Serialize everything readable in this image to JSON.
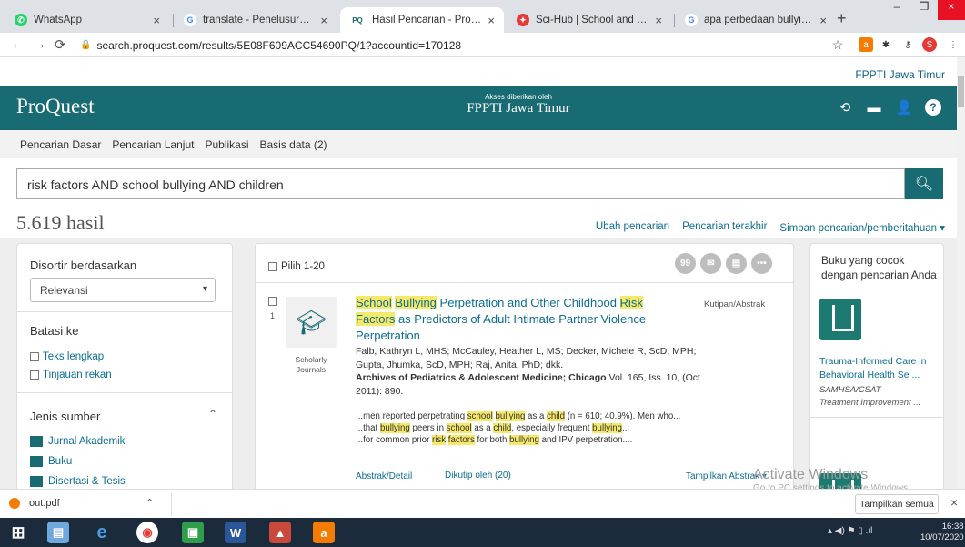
{
  "browser": {
    "tabs": [
      {
        "title": "WhatsApp",
        "color": "#25d366",
        "glyph": "W"
      },
      {
        "title": "translate - Penelusuran Google",
        "color": "#4285f4",
        "glyph": "G"
      },
      {
        "title": "Hasil Pencarian - ProQuest",
        "color": "#186b73",
        "glyph": "PQ"
      },
      {
        "title": "Sci-Hub | School and Family Fac",
        "color": "#e53935",
        "glyph": "S"
      },
      {
        "title": "apa perbedaan bullying dengan",
        "color": "#4285f4",
        "glyph": "G"
      }
    ],
    "url": "search.proquest.com/results/5E08F609ACC54690PQ/1?accountid=170128"
  },
  "site": {
    "institution_top": "FPPTI Jawa Timur",
    "logo": "ProQuest",
    "access_small": "Akses diberikan oleh",
    "access_name": "FPPTI Jawa Timur",
    "nav": [
      "Pencarian Dasar",
      "Pencarian Lanjut",
      "Publikasi",
      "Basis data (2)"
    ],
    "query": "risk factors AND school bullying AND children",
    "count": "5.619 hasil",
    "links": [
      "Ubah pencarian",
      "Pencarian terakhir",
      "Simpan pencarian/pemberitahuan ▾"
    ]
  },
  "left": {
    "sort_label": "Disortir berdasarkan",
    "sort_value": "Relevansi",
    "limit_label": "Batasi ke",
    "checks": [
      "Teks lengkap",
      "Tinjauan rekan"
    ],
    "source_label": "Jenis sumber",
    "sources": [
      "Jurnal Akademik",
      "Buku",
      "Disertasi & Tesis"
    ]
  },
  "mid": {
    "select_label": "Pilih 1-20",
    "index": "1",
    "source_type": "Scholarly Journals",
    "cite_label": "Kutipan/Abstrak",
    "authors": "Falb, Kathryn L, MHS; McCauley, Heather L, MS; Decker, Michele R, ScD, MPH; Gupta, Jhumka, ScD, MPH; Raj, Anita, PhD; dkk.",
    "journal": "Archives of Pediatrics & Adolescent Medicine; Chicago",
    "vol": " Vol. 165, Iss. 10, (Oct 2011): 890.",
    "link1": "Abstrak/Detail",
    "link2": "Dikutip oleh (20)",
    "link3": "Tampilkan Abstrak ▾"
  },
  "right": {
    "heading": "Buku yang cocok dengan pencarian Anda",
    "book_title": "Trauma-Informed Care in Behavioral Health Se ...",
    "book_pub": "SAMHSA/CSAT",
    "book_series": "Treatment Improvement ..."
  },
  "os": {
    "download": "out.pdf",
    "show_all": "Tampilkan semua",
    "watermark": "Activate Windows",
    "watermark_sub": "Go to PC settings to activate Windows.",
    "time": "16:38",
    "date": "10/07/2020"
  }
}
